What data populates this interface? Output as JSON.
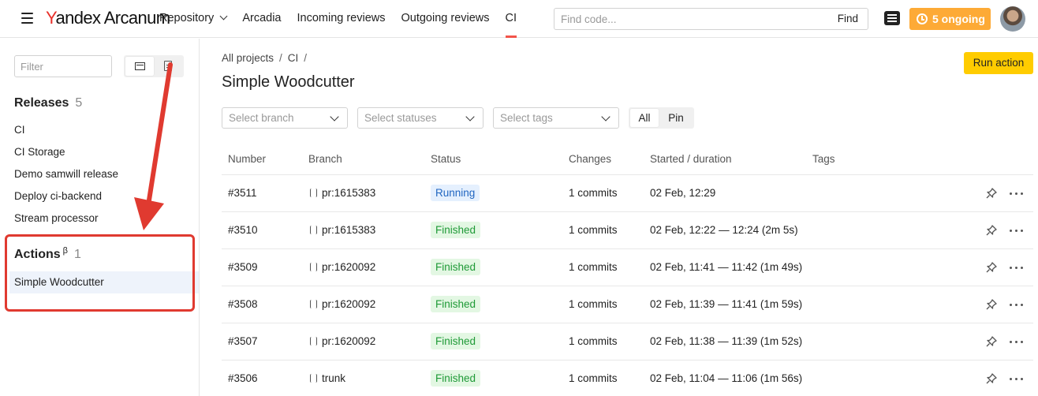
{
  "header": {
    "logo_y": "Y",
    "logo_rest": "andex Arcanum",
    "nav": [
      {
        "label": "Repository"
      },
      {
        "label": "Arcadia"
      },
      {
        "label": "Incoming reviews"
      },
      {
        "label": "Outgoing reviews"
      },
      {
        "label": "CI"
      }
    ],
    "search_placeholder": "Find code...",
    "find_label": "Find",
    "ongoing_label": "5 ongoing",
    "accent_color": "#f2544a",
    "ongoing_color": "#fdaa36"
  },
  "sidebar": {
    "filter_placeholder": "Filter",
    "releases": {
      "title": "Releases",
      "count": "5",
      "items": [
        "CI",
        "CI Storage",
        "Demo samwill release",
        "Deploy ci-backend",
        "Stream processor"
      ]
    },
    "actions": {
      "title": "Actions",
      "beta": "β",
      "count": "1",
      "items": [
        "Simple Woodcutter"
      ]
    },
    "annotation_color": "#e03a30"
  },
  "main": {
    "breadcrumb": [
      "All projects",
      "CI"
    ],
    "breadcrumb_sep": "/",
    "title": "Simple Woodcutter",
    "run_action_label": "Run action",
    "run_action_color": "#ffcc00",
    "filters": {
      "branch_placeholder": "Select branch",
      "statuses_placeholder": "Select statuses",
      "tags_placeholder": "Select tags",
      "toggle_all": "All",
      "toggle_pin": "Pin"
    },
    "table": {
      "columns": [
        "Number",
        "Branch",
        "Status",
        "Changes",
        "Started / duration",
        "Tags"
      ],
      "rows": [
        {
          "number": "#3511",
          "branch": "pr:1615383",
          "status": "Running",
          "changes": "1 commits",
          "started": "02 Feb, 12:29"
        },
        {
          "number": "#3510",
          "branch": "pr:1615383",
          "status": "Finished",
          "changes": "1 commits",
          "started": "02 Feb, 12:22 — 12:24 (2m 5s)"
        },
        {
          "number": "#3509",
          "branch": "pr:1620092",
          "status": "Finished",
          "changes": "1 commits",
          "started": "02 Feb, 11:41 — 11:42 (1m 49s)"
        },
        {
          "number": "#3508",
          "branch": "pr:1620092",
          "status": "Finished",
          "changes": "1 commits",
          "started": "02 Feb, 11:39 — 11:41 (1m 59s)"
        },
        {
          "number": "#3507",
          "branch": "pr:1620092",
          "status": "Finished",
          "changes": "1 commits",
          "started": "02 Feb, 11:38 — 11:39 (1m 52s)"
        },
        {
          "number": "#3506",
          "branch": "trunk",
          "status": "Finished",
          "changes": "1 commits",
          "started": "02 Feb, 11:04 — 11:06 (1m 56s)"
        }
      ]
    }
  }
}
